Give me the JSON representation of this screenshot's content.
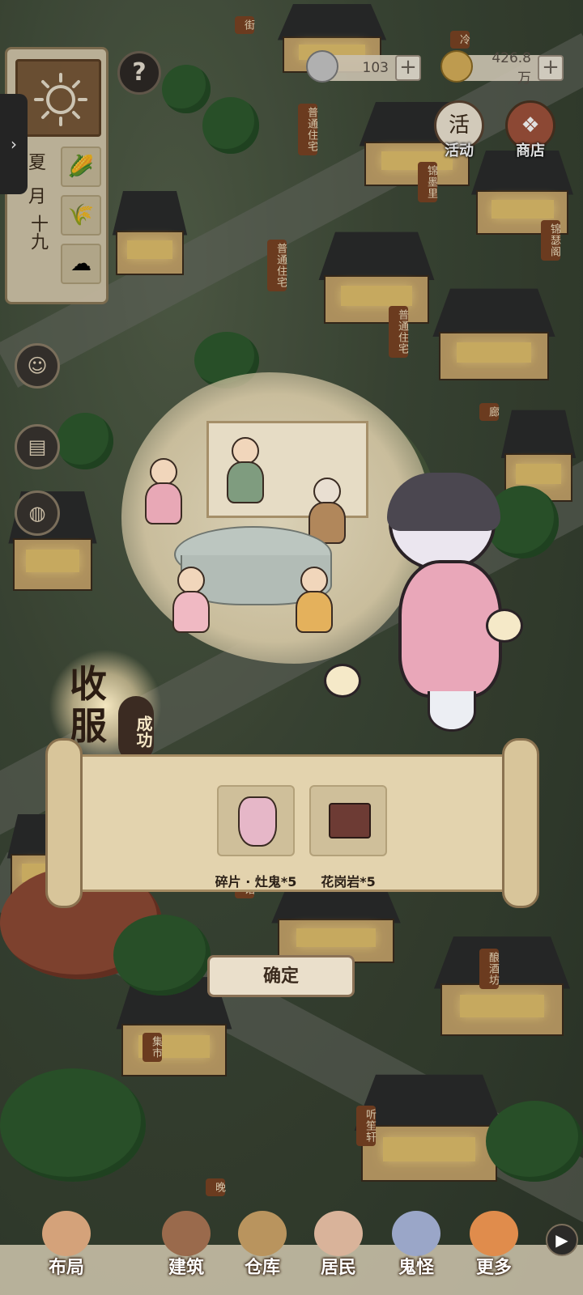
{
  "hud": {
    "season": "夏",
    "month": "月",
    "day": "十九",
    "silver": "103",
    "coins": "426.8万",
    "help_label": "?",
    "plus": "+",
    "activity_label": "活动",
    "activity_icon_text": "活",
    "shop_label": "商店"
  },
  "map_signs": {
    "s1": "街",
    "s2": "普通住宅",
    "s3": "锦墨里",
    "s4": "普通住宅",
    "s5": "普通住宅",
    "s6": "锦瑟阁",
    "s7": "廊",
    "s8": "馆",
    "s9": "酿酒坊",
    "s10": "集市",
    "s11": "听笙轩",
    "s12": "晚",
    "s13": "冷"
  },
  "dialog": {
    "title_1": "收",
    "title_2": "服",
    "title_seal": "成功",
    "rewards": [
      {
        "name": "碎片 · 灶鬼*5",
        "icon": "ghost-shard-icon"
      },
      {
        "name": "花岗岩*5",
        "icon": "granite-icon"
      }
    ],
    "confirm": "确定"
  },
  "nav": {
    "items": [
      {
        "label": "布局",
        "icon": "layout-icon"
      },
      {
        "label": "建筑",
        "icon": "building-icon"
      },
      {
        "label": "仓库",
        "icon": "warehouse-icon"
      },
      {
        "label": "居民",
        "icon": "residents-icon"
      },
      {
        "label": "鬼怪",
        "icon": "ghost-icon"
      },
      {
        "label": "更多",
        "icon": "more-icon"
      }
    ],
    "arrow": "▶"
  },
  "colors": {
    "accent": "#7a4424",
    "paper": "#e3d3ae",
    "ghost_dress": "#e9a7b9"
  }
}
